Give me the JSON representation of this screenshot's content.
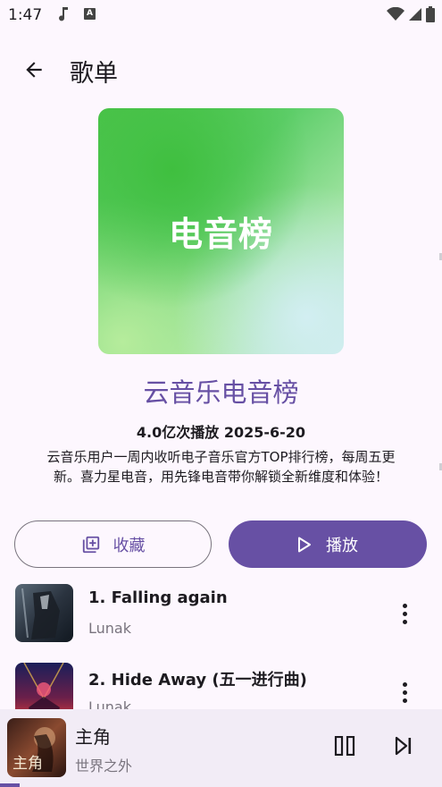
{
  "status": {
    "time": "1:47"
  },
  "header": {
    "title": "歌单"
  },
  "playlist": {
    "cover_text": "电音榜",
    "name": "云音乐电音榜",
    "meta": "4.0亿次播放 2025-6-20",
    "description": "云音乐用户一周内收听电子音乐官方TOP排行榜，每周五更新。喜力星电音，用先锋电音带你解锁全新维度和体验！"
  },
  "actions": {
    "favorite_label": "收藏",
    "play_label": "播放"
  },
  "tracks": [
    {
      "title": "1. Falling again",
      "artist": "Lunak"
    },
    {
      "title": "2. Hide Away (五一进行曲)",
      "artist": "Lunak"
    }
  ],
  "now_playing": {
    "title": "主角",
    "artist": "世界之外",
    "art_text": "主角"
  },
  "colors": {
    "accent": "#6750a4",
    "background": "#fdf7fe",
    "player_bg": "#f2ecf6"
  },
  "icons": [
    "back-arrow-icon",
    "music-note-icon",
    "wifi-icon",
    "signal-icon",
    "battery-icon",
    "library-add-icon",
    "play-icon",
    "more-vert-icon",
    "pause-icon",
    "skip-next-icon"
  ]
}
